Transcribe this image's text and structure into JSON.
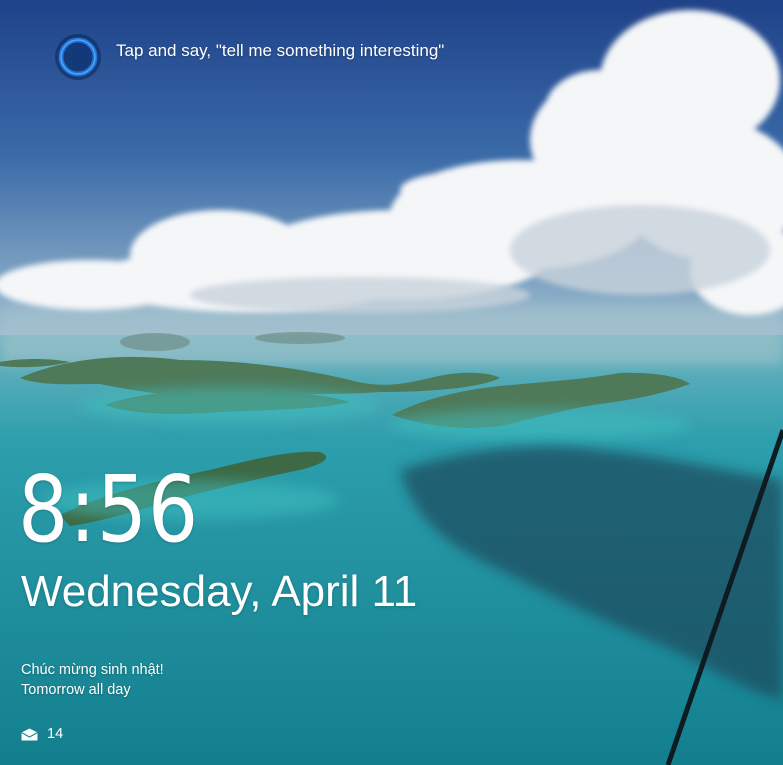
{
  "cortana": {
    "prompt": "Tap and say, \"tell me something interesting\"",
    "icon": "cortana-ring-icon",
    "ring_color": "#2b7fd6"
  },
  "clock": {
    "time": "8:56",
    "date": "Wednesday, April 11"
  },
  "calendar": {
    "title": "Chúc mừng sinh nhật!",
    "when": "Tomorrow all day"
  },
  "notifications": {
    "mail_icon": "mail-icon",
    "mail_count": "14"
  },
  "background": {
    "sky_color": "#27509a",
    "sea_color": "#1f8f9c"
  }
}
